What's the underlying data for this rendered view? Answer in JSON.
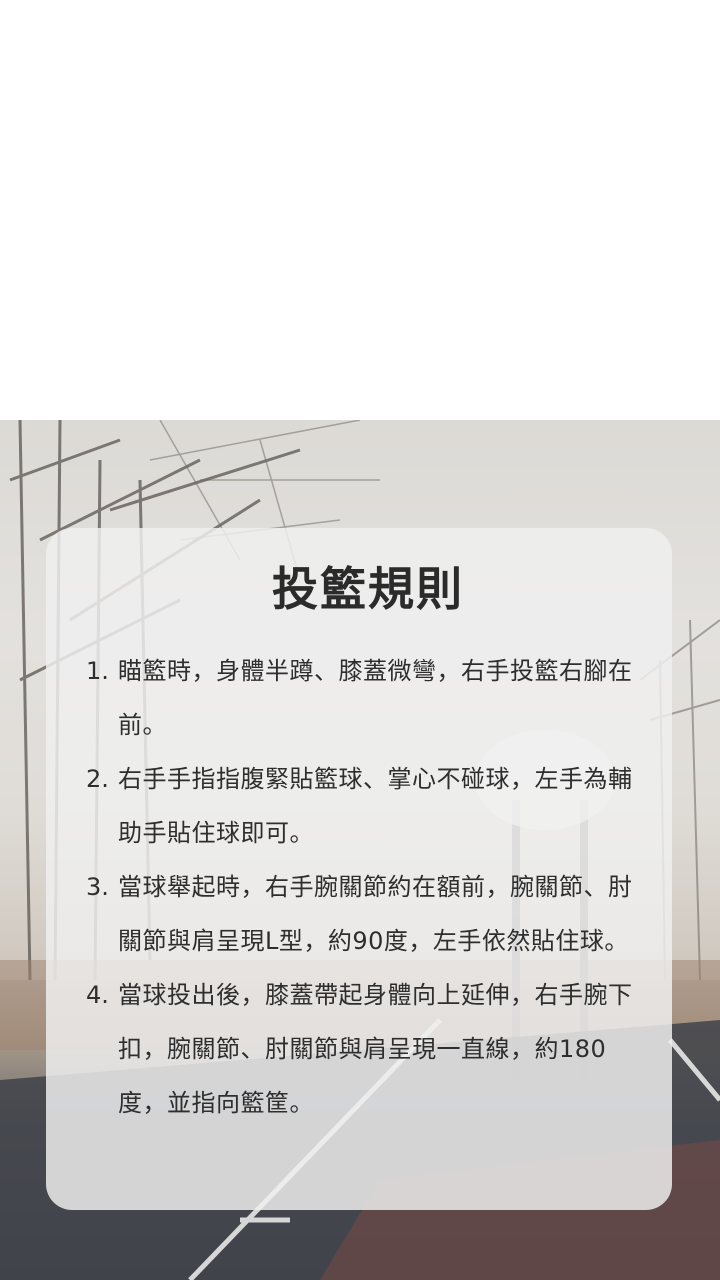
{
  "card": {
    "title": "投籃規則",
    "rules": [
      {
        "number": "1.",
        "text": "瞄籃時，身體半蹲、膝蓋微彎，右手投籃右腳在前。"
      },
      {
        "number": "2.",
        "text": "右手手指指腹緊貼籃球、掌心不碰球，左手為輔助手貼住球即可。"
      },
      {
        "number": "3.",
        "text": "當球舉起時，右手腕關節約在額前，腕關節、肘關節與肩呈現L型，約90度，左手依然貼住球。"
      },
      {
        "number": "4.",
        "text": "當球投出後，膝蓋帶起身體向上延伸，右手腕下扣，腕關節、肘關節與肩呈現一直線，約180度，並指向籃筐。"
      }
    ]
  },
  "colors": {
    "card_background": "#f0f0f0",
    "title_text": "#2b2b2b",
    "body_text": "#2e2e2e",
    "page_background": "#ffffff"
  }
}
